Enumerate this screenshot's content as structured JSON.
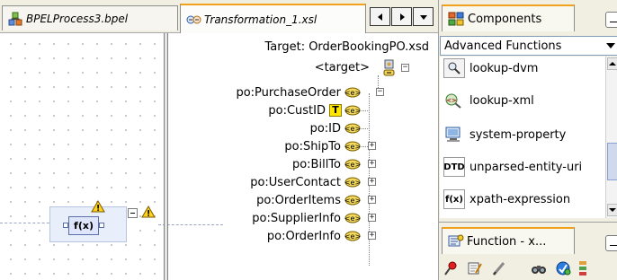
{
  "editor": {
    "tabs": [
      {
        "label": "BPELProcess3.bpel",
        "icon": "bpel-process-icon",
        "active": false
      },
      {
        "label": "Transformation_1.xsl",
        "icon": "xsl-transform-icon",
        "active": true
      }
    ],
    "nav_buttons": [
      "tab-scroll-left-icon",
      "tab-scroll-right-icon",
      "tab-list-dropdown-icon"
    ]
  },
  "mapper": {
    "target_title": "Target: OrderBookingPO.xsd",
    "target_nodes": [
      {
        "label": "<target>",
        "type": "root"
      },
      {
        "label": "po:PurchaseOrder",
        "type": "element",
        "expander": "minus"
      },
      {
        "label": "po:CustID",
        "type": "element",
        "badge": "T"
      },
      {
        "label": "po:ID",
        "type": "element"
      },
      {
        "label": "po:ShipTo",
        "type": "element",
        "expander": "plus"
      },
      {
        "label": "po:BillTo",
        "type": "element",
        "expander": "plus"
      },
      {
        "label": "po:UserContact",
        "type": "element",
        "expander": "plus"
      },
      {
        "label": "po:OrderItems",
        "type": "element",
        "expander": "plus"
      },
      {
        "label": "po:SupplierInfo",
        "type": "element",
        "expander": "plus"
      },
      {
        "label": "po:OrderInfo",
        "type": "element",
        "expander": "plus"
      }
    ],
    "function_box": {
      "label": "f(x)",
      "warning": true
    }
  },
  "components_panel": {
    "tab_label": "Components",
    "category": "Advanced Functions",
    "items": [
      {
        "label": "lookup-dvm",
        "icon": "lookup-dvm-icon"
      },
      {
        "label": "lookup-xml",
        "icon": "lookup-xml-icon"
      },
      {
        "label": "system-property",
        "icon": "system-property-icon"
      },
      {
        "label": "unparsed-entity-uri",
        "icon": "dtd-icon",
        "glyph": "DTD"
      },
      {
        "label": "xpath-expression",
        "icon": "function-icon",
        "glyph": "f(x)"
      }
    ]
  },
  "function_panel": {
    "tab_label": "Function - x...",
    "toolbar": [
      "pin-icon",
      "edit-properties-icon",
      "pencil-icon",
      "binoculars-icon",
      "refresh-icon",
      "more-icon"
    ]
  }
}
